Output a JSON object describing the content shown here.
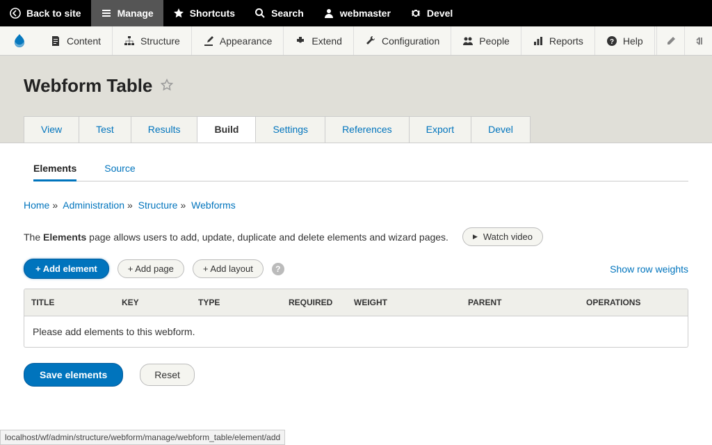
{
  "topbar": {
    "back": "Back to site",
    "manage": "Manage",
    "shortcuts": "Shortcuts",
    "search": "Search",
    "user": "webmaster",
    "devel": "Devel"
  },
  "adminbar": {
    "items": [
      {
        "label": "Content"
      },
      {
        "label": "Structure"
      },
      {
        "label": "Appearance"
      },
      {
        "label": "Extend"
      },
      {
        "label": "Configuration"
      },
      {
        "label": "People"
      },
      {
        "label": "Reports"
      },
      {
        "label": "Help"
      }
    ]
  },
  "page": {
    "title": "Webform Table"
  },
  "primtabs": [
    "View",
    "Test",
    "Results",
    "Build",
    "Settings",
    "References",
    "Export",
    "Devel"
  ],
  "primtabs_active": 3,
  "sectabs": [
    "Elements",
    "Source"
  ],
  "sectabs_active": 0,
  "breadcrumb": [
    "Home",
    "Administration",
    "Structure",
    "Webforms"
  ],
  "description": {
    "pre": "The ",
    "bold": "Elements",
    "post": " page allows users to add, update, duplicate and delete elements and wizard pages.",
    "watch_video": "Watch video"
  },
  "actions": {
    "add_element": "+ Add element",
    "add_page": "+ Add page",
    "add_layout": "+ Add layout",
    "show_row_weights": "Show row weights"
  },
  "table": {
    "headers": [
      "TITLE",
      "KEY",
      "TYPE",
      "REQUIRED",
      "WEIGHT",
      "PARENT",
      "OPERATIONS"
    ],
    "empty": "Please add elements to this webform."
  },
  "buttons": {
    "save": "Save elements",
    "reset": "Reset"
  },
  "statusbar": "localhost/wf/admin/structure/webform/manage/webform_table/element/add"
}
